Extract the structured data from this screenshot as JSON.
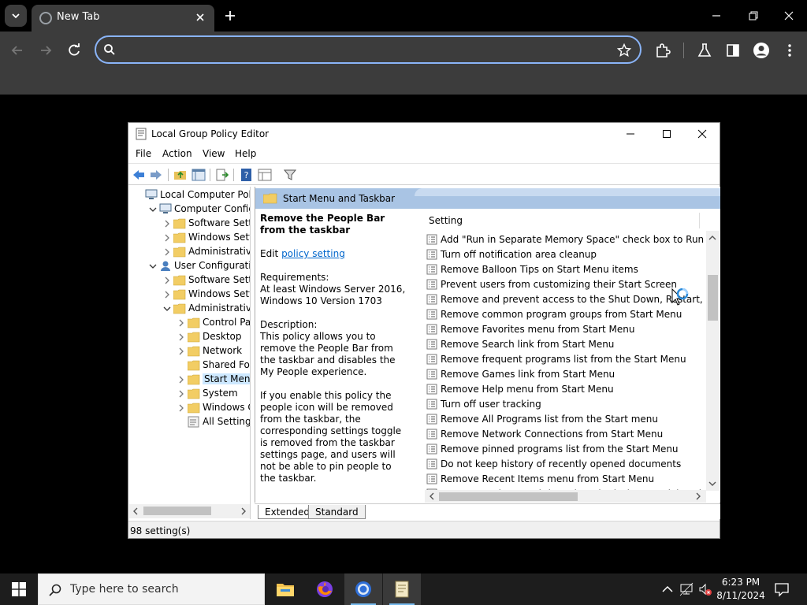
{
  "browser": {
    "tab_title": "New Tab",
    "omnibox_value": "",
    "omnibox_placeholder": ""
  },
  "gpedit": {
    "title": "Local Group Policy Editor",
    "menu": [
      "File",
      "Action",
      "View",
      "Help"
    ],
    "tree": [
      {
        "label": "Local Computer Policy",
        "indent": 0,
        "twisty": "",
        "icon": "computer"
      },
      {
        "label": "Computer Configura",
        "indent": 1,
        "twisty": "expanded",
        "icon": "computer"
      },
      {
        "label": "Software Settings",
        "indent": 2,
        "twisty": "collapsed",
        "icon": "folder"
      },
      {
        "label": "Windows Setting",
        "indent": 2,
        "twisty": "collapsed",
        "icon": "folder"
      },
      {
        "label": "Administrative Te",
        "indent": 2,
        "twisty": "collapsed",
        "icon": "folder"
      },
      {
        "label": "User Configuration",
        "indent": 1,
        "twisty": "expanded",
        "icon": "user"
      },
      {
        "label": "Software Settings",
        "indent": 2,
        "twisty": "collapsed",
        "icon": "folder"
      },
      {
        "label": "Windows Setting",
        "indent": 2,
        "twisty": "collapsed",
        "icon": "folder"
      },
      {
        "label": "Administrative Te",
        "indent": 2,
        "twisty": "expanded",
        "icon": "folder"
      },
      {
        "label": "Control Panel",
        "indent": 3,
        "twisty": "collapsed",
        "icon": "folder"
      },
      {
        "label": "Desktop",
        "indent": 3,
        "twisty": "collapsed",
        "icon": "folder"
      },
      {
        "label": "Network",
        "indent": 3,
        "twisty": "collapsed",
        "icon": "folder"
      },
      {
        "label": "Shared Folder",
        "indent": 3,
        "twisty": "",
        "icon": "folder"
      },
      {
        "label": "Start Menu ar",
        "indent": 3,
        "twisty": "collapsed",
        "icon": "folder",
        "selected": true
      },
      {
        "label": "System",
        "indent": 3,
        "twisty": "collapsed",
        "icon": "folder"
      },
      {
        "label": "Windows Cor",
        "indent": 3,
        "twisty": "collapsed",
        "icon": "folder"
      },
      {
        "label": "All Settings",
        "indent": 3,
        "twisty": "",
        "icon": "settings"
      }
    ],
    "detail_header": "Start Menu and Taskbar",
    "description": {
      "title": "Remove the People Bar from the taskbar",
      "edit_prefix": "Edit ",
      "edit_link": "policy setting ",
      "requirements_label": "Requirements:",
      "requirements": "At least Windows Server 2016, Windows 10 Version 1703",
      "description_label": "Description:",
      "description": "This policy allows you to remove the People Bar from the taskbar and disables the My People experience.",
      "description2": "If you enable this policy the people icon will be removed from the taskbar, the corresponding settings toggle is removed from the taskbar settings page, and users will not be able to pin people to the taskbar."
    },
    "list_header": "Setting",
    "settings": [
      "Add \"Run in Separate Memory Space\" check box to Run dial...",
      "Turn off notification area cleanup",
      "Remove Balloon Tips on Start Menu items",
      "Prevent users from customizing their Start Screen",
      "Remove and prevent access to the Shut Down, Restart, Slee...",
      "Remove common program groups from Start Menu",
      "Remove Favorites menu from Start Menu",
      "Remove Search link from Start Menu",
      "Remove frequent programs list from the Start Menu",
      "Remove Games link from Start Menu",
      "Remove Help menu from Start Menu",
      "Turn off user tracking",
      "Remove All Programs list from the Start menu",
      "Remove Network Connections from Start Menu",
      "Remove pinned programs list from the Start Menu",
      "Do not keep history of recently opened documents",
      "Remove Recent Items menu from Start Menu",
      "Do not use the search-based method when resolving shell s..."
    ],
    "tabs": [
      "Extended",
      "Standard"
    ],
    "status": "98 setting(s)"
  },
  "taskbar": {
    "search_placeholder": "Type here to search",
    "time": "6:23 PM",
    "date": "8/11/2024"
  },
  "colors": {
    "chrome_bg": "#000000",
    "toolbar_bg": "#3c3c3c",
    "omnibox_focus": "#8ab4f8",
    "detail_header": "#a9c4e4",
    "link": "#0066cc",
    "taskbar_bg": "#1d1d1d"
  }
}
